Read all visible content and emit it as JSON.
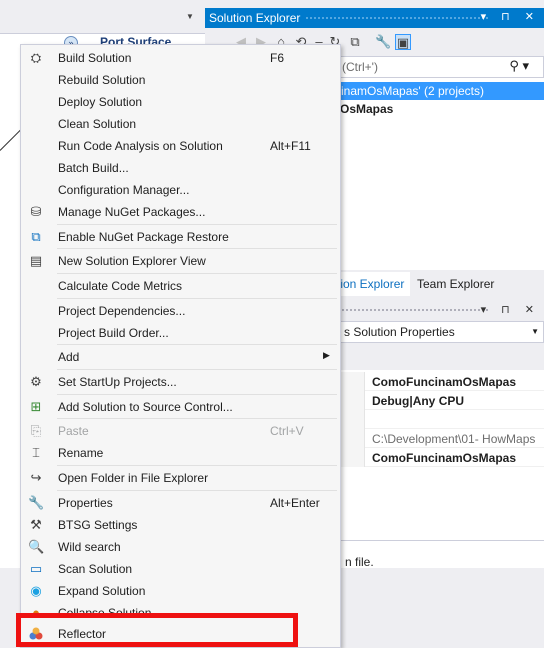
{
  "background": {
    "designer": {
      "port_label": "Port Surface",
      "port_glyph": "»"
    },
    "solution_explorer": {
      "title": "Solution Explorer",
      "title_buttons": "▾ ⊓ ✕",
      "search_placeholder": "(Ctrl+')",
      "solution_row": "cinamOsMapas' (2 projects)",
      "project_row": "OsMapas",
      "tabs": [
        "tion Explorer",
        "Team Explorer"
      ]
    },
    "properties": {
      "title_buttons": "▾ ⊓ ✕",
      "combo": "s  Solution Properties",
      "rows": [
        {
          "value": "ComoFuncinamOsMapas",
          "style": "b"
        },
        {
          "value": "Debug|Any CPU",
          "style": "b"
        },
        {
          "value": "",
          "style": ""
        },
        {
          "value": "C:\\Development\\01- HowMaps",
          "style": "g"
        },
        {
          "value": "ComoFuncinamOsMapas",
          "style": "b"
        }
      ],
      "description": "n file."
    }
  },
  "menu": {
    "items": [
      {
        "label": "Build Solution",
        "shortcut": "F6",
        "icon": "build-icon",
        "glyph": "⛭"
      },
      {
        "label": "Rebuild Solution",
        "shortcut": "",
        "icon": "",
        "glyph": ""
      },
      {
        "label": "Deploy Solution",
        "shortcut": "",
        "icon": "",
        "glyph": ""
      },
      {
        "label": "Clean Solution",
        "shortcut": "",
        "icon": "",
        "glyph": ""
      },
      {
        "label": "Run Code Analysis on Solution",
        "shortcut": "Alt+F11",
        "icon": "",
        "glyph": ""
      },
      {
        "label": "Batch Build...",
        "shortcut": "",
        "icon": "",
        "glyph": ""
      },
      {
        "label": "Configuration Manager...",
        "shortcut": "",
        "icon": "",
        "glyph": ""
      },
      {
        "label": "Manage NuGet Packages...",
        "shortcut": "",
        "icon": "nuget-icon",
        "glyph": "⛁"
      },
      {
        "label": "Enable NuGet Package Restore",
        "shortcut": "",
        "icon": "package-restore-icon",
        "glyph": "⧉"
      },
      {
        "label": "New Solution Explorer View",
        "shortcut": "",
        "icon": "new-view-icon",
        "glyph": "▤"
      },
      {
        "label": "Calculate Code Metrics",
        "shortcut": "",
        "icon": "",
        "glyph": ""
      },
      {
        "label": "Project Dependencies...",
        "shortcut": "",
        "icon": "",
        "glyph": ""
      },
      {
        "label": "Project Build Order...",
        "shortcut": "",
        "icon": "",
        "glyph": ""
      },
      {
        "label": "Add",
        "shortcut": "",
        "icon": "",
        "glyph": "",
        "submenu": "▶"
      },
      {
        "label": "Set StartUp Projects...",
        "shortcut": "",
        "icon": "gear-icon",
        "glyph": "⚙"
      },
      {
        "label": "Add Solution to Source Control...",
        "shortcut": "",
        "icon": "source-control-icon",
        "glyph": "⊞"
      },
      {
        "label": "Paste",
        "shortcut": "Ctrl+V",
        "icon": "paste-icon",
        "glyph": "⎘",
        "disabled": true
      },
      {
        "label": "Rename",
        "shortcut": "",
        "icon": "rename-icon",
        "glyph": "⌶"
      },
      {
        "label": "Open Folder in File Explorer",
        "shortcut": "",
        "icon": "open-folder-icon",
        "glyph": "↪"
      },
      {
        "label": "Properties",
        "shortcut": "Alt+Enter",
        "icon": "wrench-icon",
        "glyph": "🔧"
      },
      {
        "label": "BTSG Settings",
        "shortcut": "",
        "icon": "tools-icon",
        "glyph": "⚒"
      },
      {
        "label": "Wild search",
        "shortcut": "",
        "icon": "search-icon",
        "glyph": "🔍"
      },
      {
        "label": "Scan Solution",
        "shortcut": "",
        "icon": "scan-icon",
        "glyph": "▭"
      },
      {
        "label": "Expand Solution",
        "shortcut": "",
        "icon": "eye-icon",
        "glyph": "◉"
      },
      {
        "label": "Collapse Solution",
        "shortcut": "",
        "icon": "collapse-icon",
        "glyph": "●"
      },
      {
        "label": "Reflector",
        "shortcut": "",
        "icon": "reflector-icon",
        "glyph": ""
      }
    ]
  },
  "colors": {
    "accent": "#007acc",
    "highlight": "#ee1111",
    "selection": "#3399ff"
  }
}
